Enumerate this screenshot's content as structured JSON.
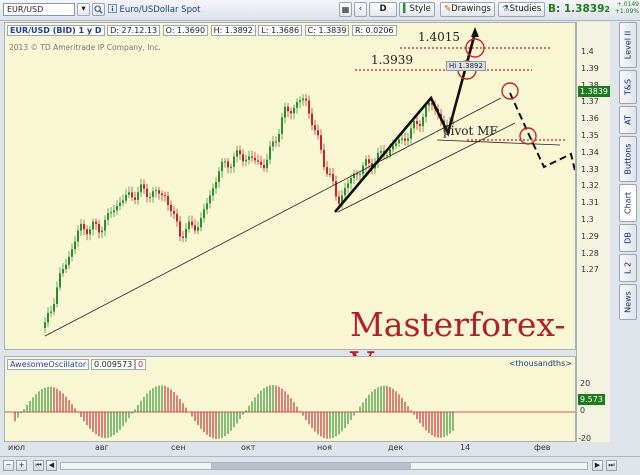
{
  "toolbar": {
    "symbol": "EUR/USD",
    "description": "Euro/USDollar Spot",
    "period": "D",
    "style_label": "Style",
    "drawings_label": "Drawings",
    "studies_label": "Studies",
    "bid_label": "B:",
    "bid_value": "1.3839",
    "bid_suffix": "2",
    "change_abs": "+.0149",
    "change_pct": "+1.09%"
  },
  "chart_header": {
    "title": "EUR/USD (BID) 1 y D",
    "date": "D: 27.12.13",
    "open": "O: 1.3690",
    "high": "H: 1.3892",
    "low": "L: 1.3686",
    "close": "C: 1.3839",
    "range": "R: 0.0206",
    "copyright": "2013 © TD Ameritrade IP Company, Inc."
  },
  "annotations": {
    "level_high": "1.4015",
    "level_prev": "1.3939",
    "hi_tag": "Hi 1.3892",
    "pivot": "pivot MF",
    "watermark": "Masterforex-V"
  },
  "price_axis": {
    "ticks": [
      "1.4",
      "1.39",
      "1.38",
      "1.37",
      "1.36",
      "1.35",
      "1.34",
      "1.33",
      "1.32",
      "1.31",
      "1.3",
      "1.29",
      "1.28",
      "1.27"
    ],
    "current_tag": "1.3839"
  },
  "oscillator": {
    "name": "AwesomeOscillator",
    "value": "0.009573",
    "param": "0",
    "units": "<thousandths>",
    "ticks": [
      "20",
      "0",
      "-20"
    ],
    "current_tag": "9.573"
  },
  "x_axis": {
    "labels": [
      "июл",
      "авг",
      "сен",
      "окт",
      "ноя",
      "дек",
      "14",
      "фев"
    ]
  },
  "side_tabs": [
    "Level II",
    "T&S",
    "AT",
    "Buttons",
    "Chart",
    "DB",
    "L 2",
    "News"
  ],
  "colors": {
    "bull": "#2a8f2a",
    "bear": "#c8232c",
    "background": "#f8f6d3",
    "watermark": "#b3202a"
  }
}
